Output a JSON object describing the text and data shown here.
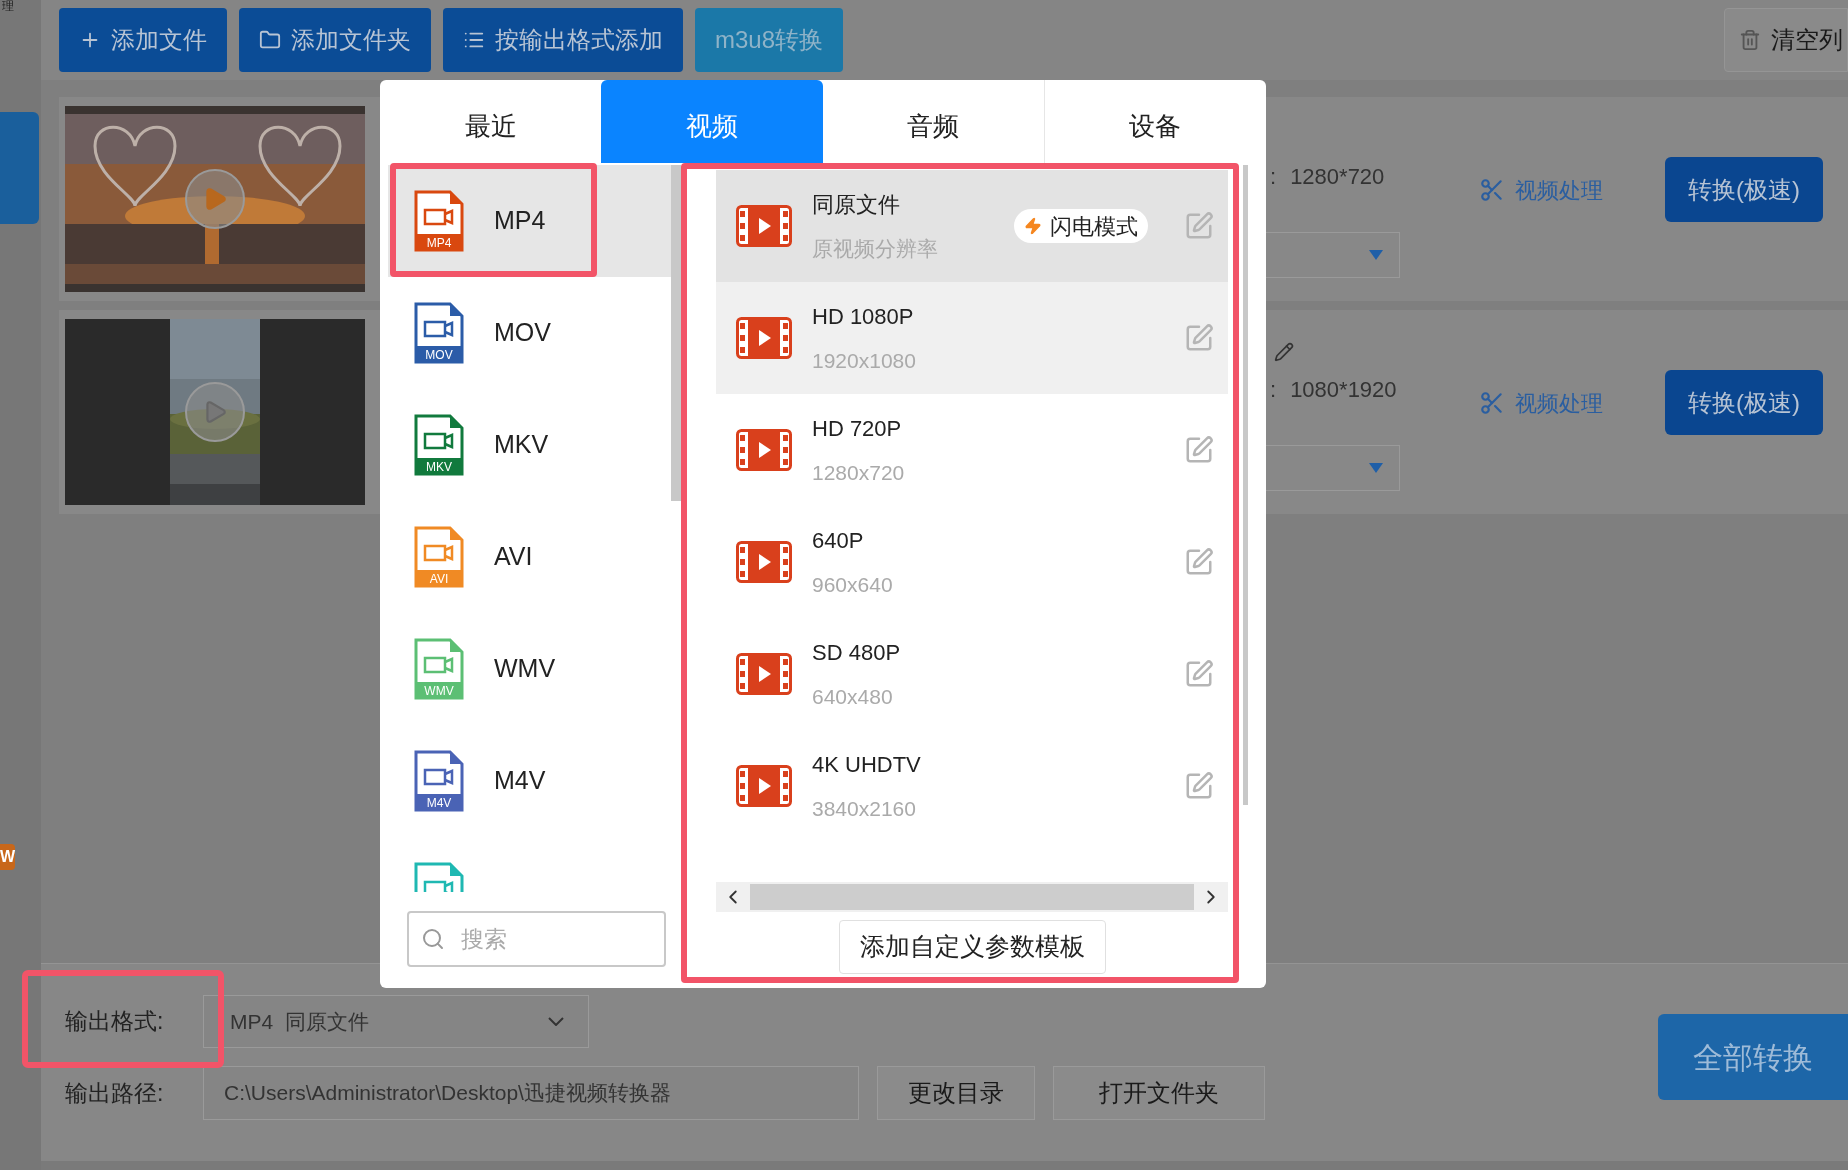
{
  "corner_fragment": "理",
  "toolbar": {
    "buttons": [
      {
        "label": "添加文件",
        "kind": "add"
      },
      {
        "label": "添加文件夹",
        "kind": "folder"
      },
      {
        "label": "按输出格式添加",
        "kind": "list"
      },
      {
        "label": "m3u8转换",
        "kind": "plain"
      }
    ],
    "clear_button": "清空列"
  },
  "sidebar": {
    "badge": "W"
  },
  "files": [
    {
      "kind": "sunset",
      "rename_icon": false,
      "separator": ":",
      "resolution": "1280*720",
      "edit_link": "视频处理",
      "convert_button": "转换(极速)"
    },
    {
      "kind": "portrait",
      "rename_icon": true,
      "separator": ":",
      "resolution": "1080*1920",
      "edit_link": "视频处理",
      "convert_button": "转换(极速)"
    }
  ],
  "format_dialog": {
    "tabs": [
      {
        "label": "最近",
        "selected": false
      },
      {
        "label": "视频",
        "selected": true
      },
      {
        "label": "音频",
        "selected": false
      },
      {
        "label": "设备",
        "selected": false
      }
    ],
    "formats": [
      {
        "name": "MP4",
        "icon_label": "MP4",
        "color": "#d9480f",
        "selected": true
      },
      {
        "name": "MOV",
        "icon_label": "MOV",
        "color": "#2b5ca8",
        "selected": false
      },
      {
        "name": "MKV",
        "icon_label": "MKV",
        "color": "#117a3d",
        "selected": false
      },
      {
        "name": "AVI",
        "icon_label": "AVI",
        "color": "#f08a24",
        "selected": false
      },
      {
        "name": "WMV",
        "icon_label": "WMV",
        "color": "#5cbf74",
        "selected": false
      },
      {
        "name": "M4V",
        "icon_label": "M4V",
        "color": "#4a63b5",
        "selected": false
      },
      {
        "color": "#1fb8b2",
        "selected": false
      }
    ],
    "search": {
      "placeholder": "搜索"
    },
    "presets": [
      {
        "title": "同原文件",
        "subtitle": "原视频分辨率",
        "badge": "闪电模式",
        "selected": true,
        "hovered": false
      },
      {
        "title": "HD 1080P",
        "subtitle": "1920x1080",
        "selected": false,
        "hovered": true
      },
      {
        "title": "HD 720P",
        "subtitle": "1280x720",
        "selected": false,
        "hovered": false
      },
      {
        "title": "640P",
        "subtitle": "960x640",
        "selected": false,
        "hovered": false
      },
      {
        "title": "SD 480P",
        "subtitle": "640x480",
        "selected": false,
        "hovered": false
      },
      {
        "title": "4K UHDTV",
        "subtitle": "3840x2160",
        "selected": false,
        "hovered": false
      }
    ],
    "add_template_button": "添加自定义参数模板"
  },
  "output": {
    "format_label": "输出格式:",
    "format_value": "MP4  同原文件",
    "path_label": "输出路径:",
    "path_value": "C:\\Users\\Administrator\\Desktop\\迅捷视频转换器",
    "change_dir_button": "更改目录",
    "open_folder_button": "打开文件夹"
  },
  "convert_all_button": "全部转换"
}
